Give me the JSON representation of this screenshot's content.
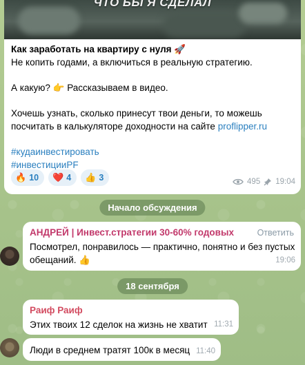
{
  "post": {
    "video_caption": "ЧТО БЫ Я СДЕЛАЛ",
    "title": "Как заработать на квартиру с нуля 🚀",
    "line1": "Не копить годами, а включиться в реальную стратегию.",
    "line2": "А какую? 👉 Рассказываем в видео.",
    "line3": "Хочешь узнать, сколько принесут твои деньги, то можешь посчитать в калькуляторе доходности на сайте",
    "link": "proflipper.ru",
    "hashtags": [
      "#кудаинвестировать",
      "#инвестицииPF"
    ],
    "reactions": [
      {
        "emoji": "🔥",
        "count": "10"
      },
      {
        "emoji": "❤️",
        "count": "4"
      },
      {
        "emoji": "👍",
        "count": "3"
      }
    ],
    "views": "495",
    "time": "19:04"
  },
  "discussion_start": "Начало обсуждения",
  "comment1": {
    "sender": "АНДРЕЙ | Инвест.стратегии 30-60% годовых",
    "reply_label": "Ответить",
    "text": "Посмотрел, понравилось — практично, понятно и без пустых обещаний. 👍",
    "time": "19:06"
  },
  "date_separator": "18 сентября",
  "comment2": {
    "sender": "Раиф Раиф",
    "text": "Этих твоих 12 сделок на жизнь не хватит",
    "time": "11:31"
  },
  "comment3": {
    "text": "Люди в среднем тратят 100к в месяц",
    "time": "11:40"
  },
  "colors": {
    "link": "#2a7fbf",
    "sender1": "#c2396b",
    "sender2": "#d24a5f",
    "chat_bg": "#a9c48e"
  }
}
